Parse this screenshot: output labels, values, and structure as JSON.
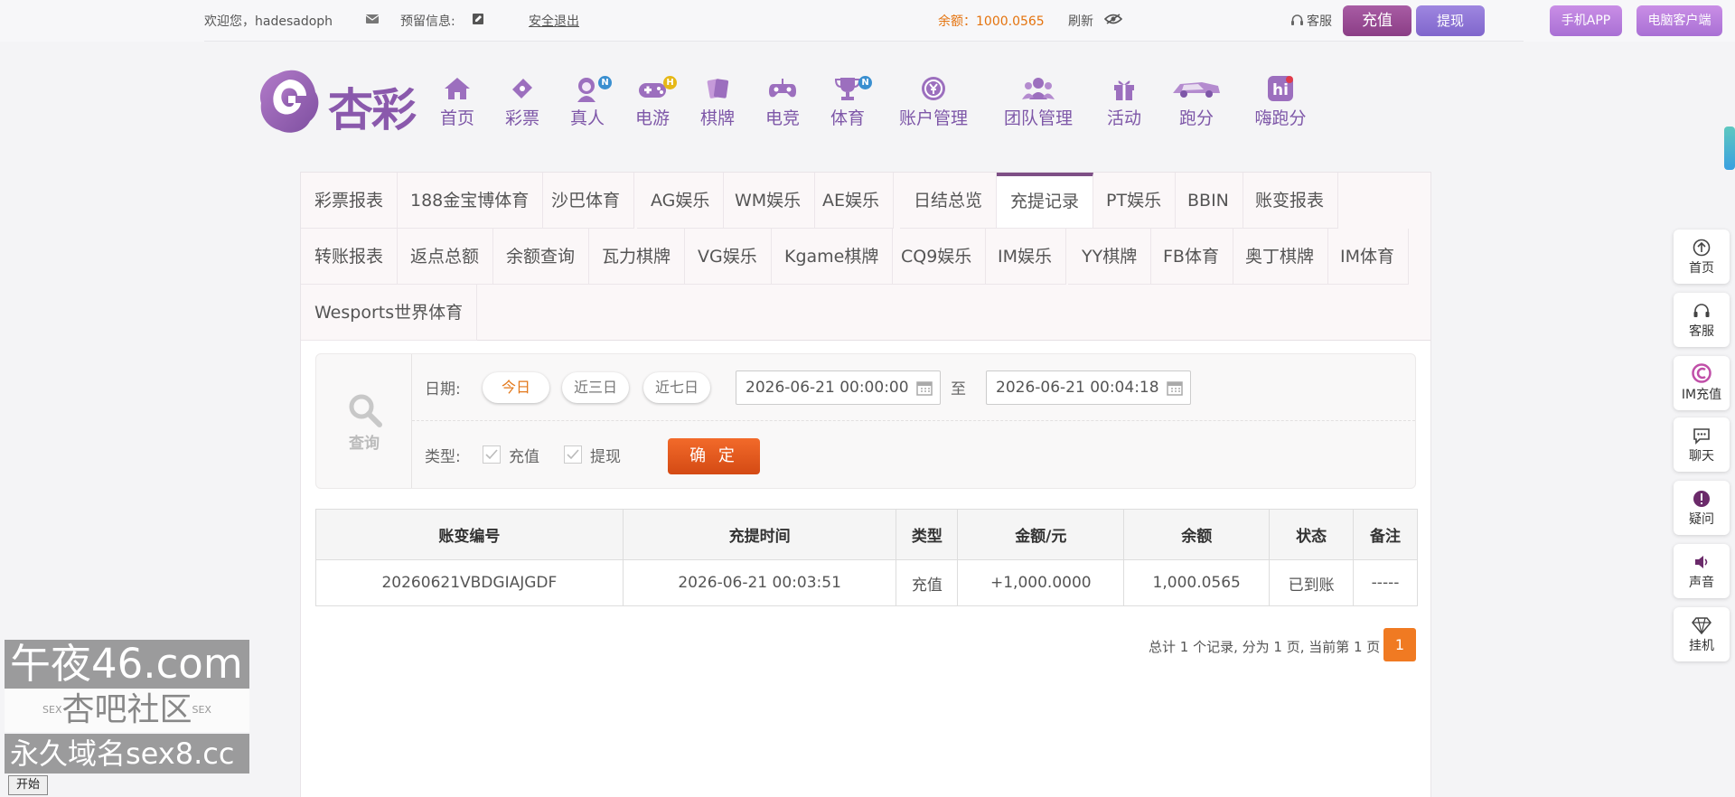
{
  "topbar": {
    "welcome": "欢迎您，hadesadoph",
    "reserved_info": "预留信息:",
    "logout": "安全退出",
    "balance": "余额：1000.0565",
    "refresh": "刷新",
    "recharge": "充值",
    "withdraw": "提现",
    "service": "客服",
    "mobile_app": "手机APP",
    "pc_client": "电脑客户端"
  },
  "logo": {
    "text": "杏彩"
  },
  "nav": [
    {
      "label": "首页",
      "icon": "home-icon"
    },
    {
      "label": "彩票",
      "icon": "lottery-ticket-icon"
    },
    {
      "label": "真人",
      "icon": "live-dealer-icon",
      "badge": "N"
    },
    {
      "label": "电游",
      "icon": "gamepad-icon",
      "badge": "H"
    },
    {
      "label": "棋牌",
      "icon": "cards-icon"
    },
    {
      "label": "电竞",
      "icon": "esports-controller-icon"
    },
    {
      "label": "体育",
      "icon": "trophy-icon",
      "badge": "N"
    },
    {
      "label": "账户管理",
      "icon": "account-coin-icon"
    },
    {
      "label": "团队管理",
      "icon": "team-users-icon"
    },
    {
      "label": "活动",
      "icon": "gift-icon"
    },
    {
      "label": "跑分",
      "icon": "car-icon"
    },
    {
      "label": "嗨跑分",
      "icon": "hi-icon"
    }
  ],
  "tabs": {
    "row1": [
      "彩票报表",
      "188金宝博体育",
      "沙巴体育",
      "AG娱乐",
      "WM娱乐",
      "AE娱乐",
      "日结总览",
      "充提记录",
      "PT娱乐",
      "BBIN",
      "账变报表"
    ],
    "row2": [
      "转账报表",
      "返点总额",
      "余额查询",
      "瓦力棋牌",
      "VG娱乐",
      "Kgame棋牌",
      "CQ9娱乐",
      "IM娱乐",
      "YY棋牌",
      "FB体育",
      "奥丁棋牌",
      "IM体育"
    ],
    "row3": [
      "Wesports世界体育"
    ],
    "active": "充提记录"
  },
  "filter": {
    "query_label": "查询",
    "date_label": "日期:",
    "chips": [
      "今日",
      "近三日",
      "近七日"
    ],
    "start_date": "2026-06-21 00:00:00",
    "to": "至",
    "end_date": "2026-06-21 00:04:18",
    "type_label": "类型:",
    "type_recharge": "充值",
    "type_withdraw": "提现",
    "confirm": "确 定"
  },
  "table": {
    "headers": [
      "账变编号",
      "充提时间",
      "类型",
      "金额/元",
      "余额",
      "状态",
      "备注"
    ],
    "rows": [
      {
        "id": "20260621VBDGIAJGDF",
        "time": "2026-06-21 00:03:51",
        "type": "充值",
        "amount": "+1,000.0000",
        "balance": "1,000.0565",
        "status": "已到账",
        "note": "-----"
      }
    ]
  },
  "pager": {
    "summary": "总计 1 个记录, 分为 1 页, 当前第 1 页",
    "current": "1"
  },
  "float_menu": [
    {
      "label": "首页",
      "icon": "arrow-up-circle-icon"
    },
    {
      "label": "客服",
      "icon": "headset-icon"
    },
    {
      "label": "IM充值",
      "icon": "im-recharge-icon"
    },
    {
      "label": "聊天",
      "icon": "chat-bubble-icon"
    },
    {
      "label": "疑问",
      "icon": "exclamation-circle-icon"
    },
    {
      "label": "声音",
      "icon": "speaker-icon"
    },
    {
      "label": "挂机",
      "icon": "diamond-icon"
    }
  ],
  "watermark": {
    "line1": "午夜46.com",
    "line2": "杏吧社区",
    "line2_deco": "SEX",
    "line3": "永久域名sex8.cc"
  },
  "taskbar": {
    "start": "开始"
  },
  "colors": {
    "brand_purple": "#7e57a8",
    "accent_orange": "#e4730e",
    "confirm_orange": "#e05a1e",
    "amount_red": "#c0121b",
    "status_green": "#1b9a2b"
  }
}
